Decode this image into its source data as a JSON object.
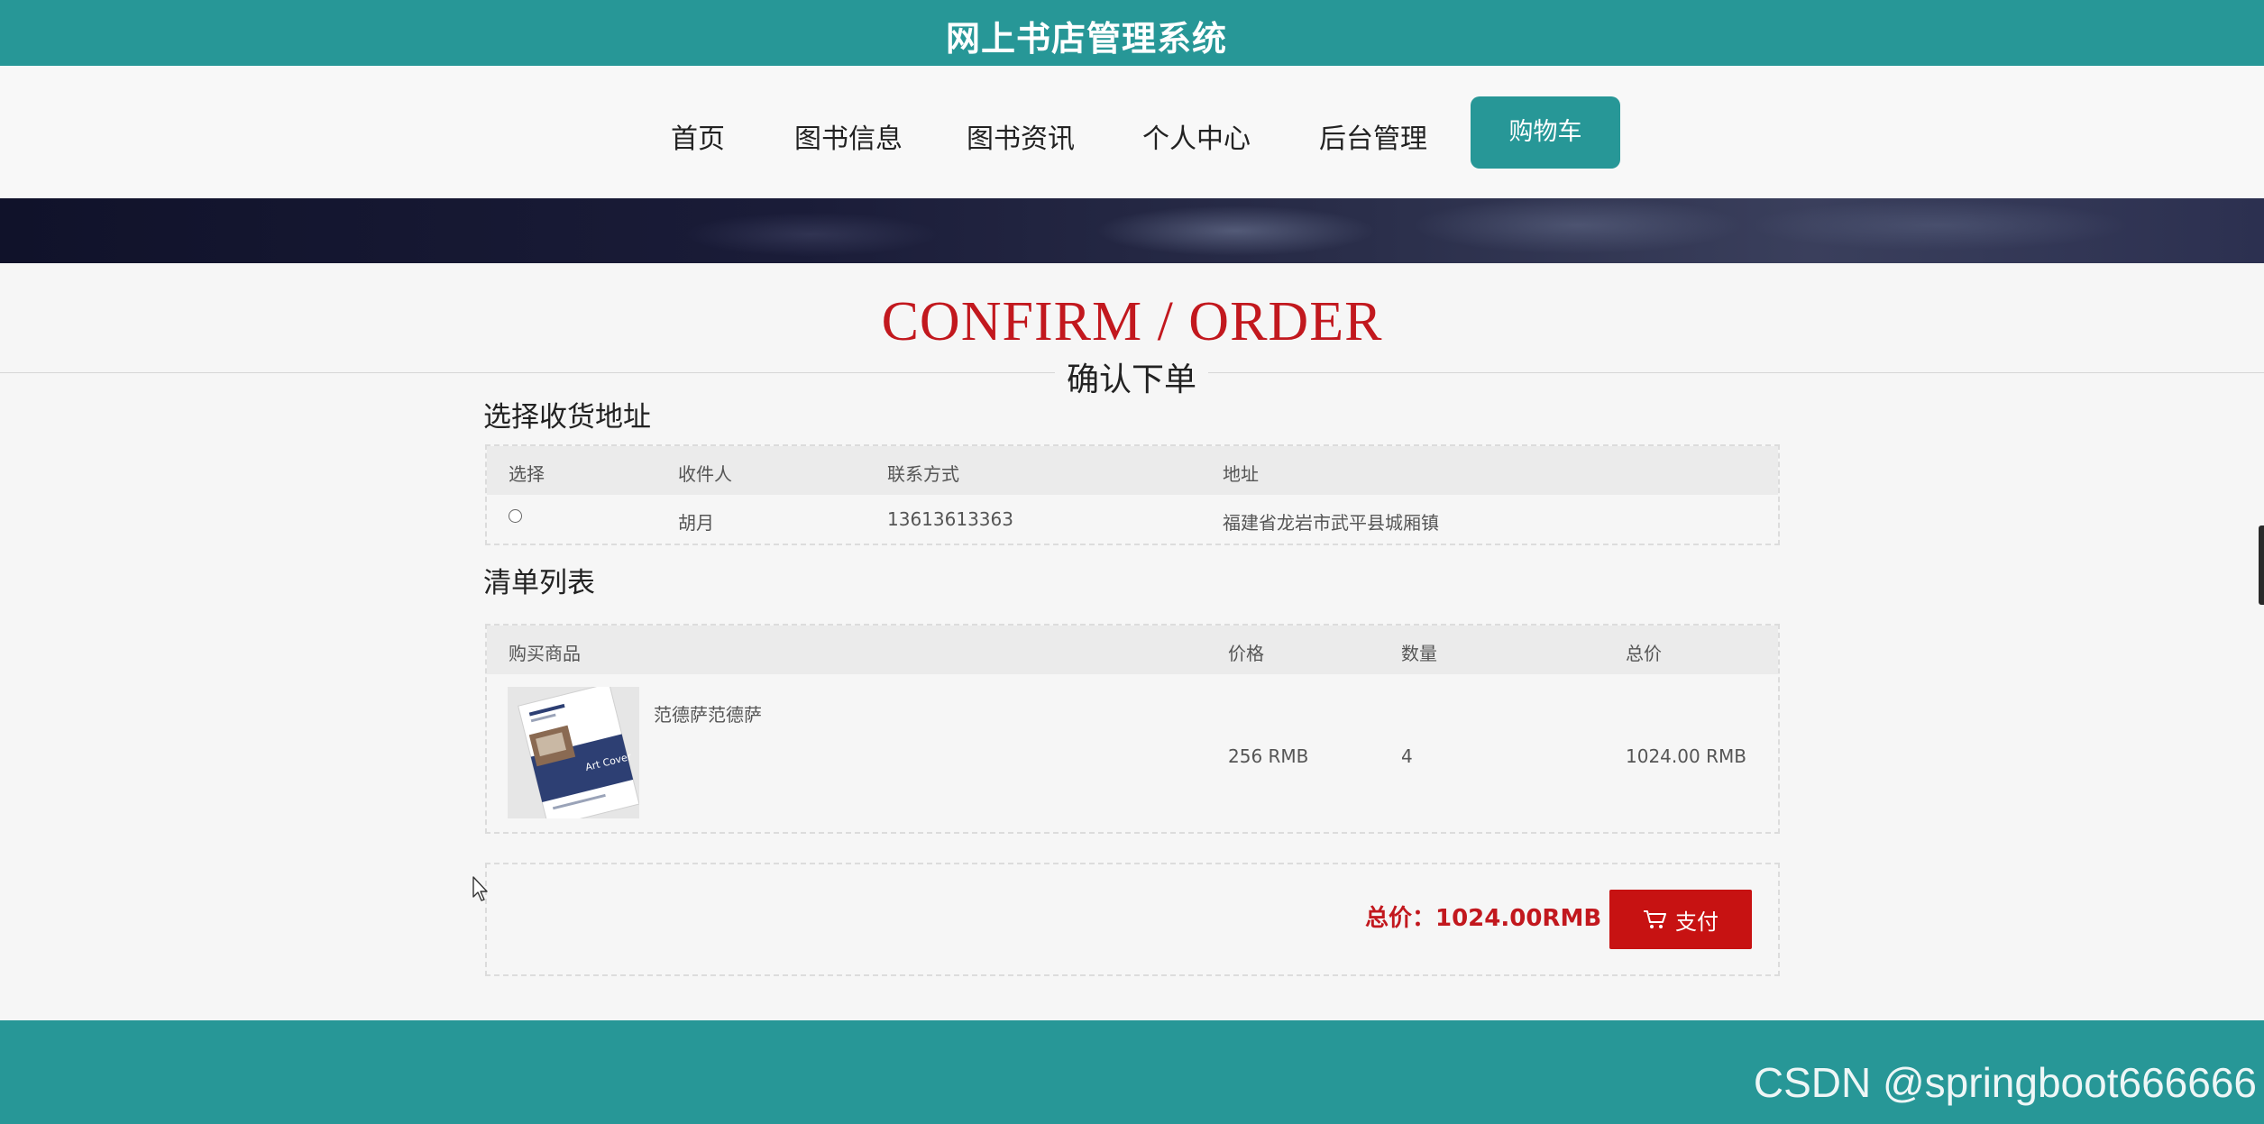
{
  "header": {
    "site_title": "网上书店管理系统"
  },
  "nav": {
    "items": [
      "首页",
      "图书信息",
      "图书资讯",
      "个人中心",
      "后台管理"
    ],
    "cart": "购物车"
  },
  "page": {
    "title_en": "CONFIRM / ORDER",
    "title_cn": "确认下单"
  },
  "address": {
    "section_title": "选择收货地址",
    "columns": [
      "选择",
      "收件人",
      "联系方式",
      "地址"
    ],
    "rows": [
      {
        "selected": false,
        "recipient": "胡月",
        "phone": "13613613363",
        "address": "福建省龙岩市武平县城厢镇"
      }
    ]
  },
  "order": {
    "section_title": "清单列表",
    "columns": [
      "购买商品",
      "价格",
      "数量",
      "总价"
    ],
    "items": [
      {
        "name": "范德萨范德萨",
        "price": "256 RMB",
        "quantity": "4",
        "total": "1024.00 RMB",
        "cover_text": "Art Cover"
      }
    ]
  },
  "summary": {
    "total_label": "总价：1024.00RMB",
    "pay_label": "支付"
  },
  "watermark": "CSDN @springboot666666",
  "colors": {
    "primary": "#279797",
    "accent_red": "#c71212",
    "title_red": "#c2181e"
  }
}
